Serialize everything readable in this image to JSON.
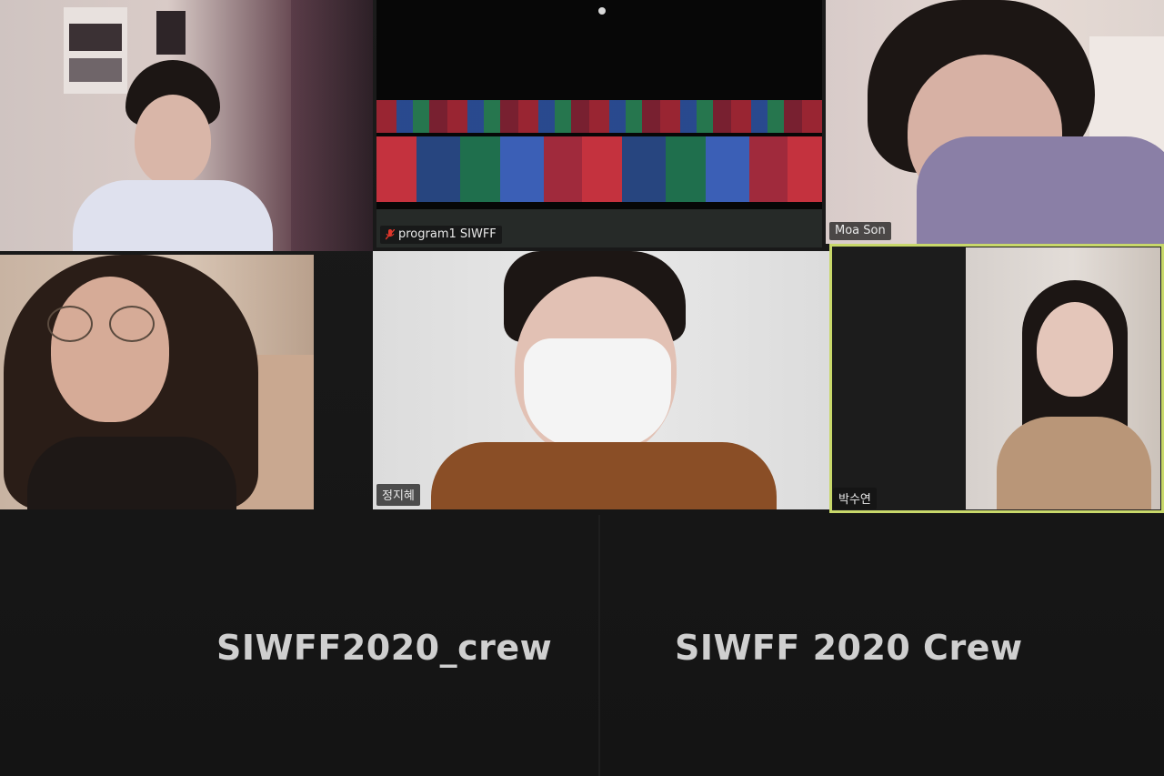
{
  "app": {
    "kind": "video-conference-gallery"
  },
  "participants": [
    {
      "id": "p1",
      "name": "",
      "muted": false,
      "active": false
    },
    {
      "id": "p2",
      "name": "program1 SIWFF",
      "muted": true,
      "active": false
    },
    {
      "id": "p3",
      "name": "Moa Son",
      "muted": false,
      "active": false
    },
    {
      "id": "p4",
      "name": "",
      "muted": false,
      "active": false
    },
    {
      "id": "p5",
      "name": "정지혜",
      "muted": false,
      "active": false
    },
    {
      "id": "p6",
      "name": "박수연",
      "muted": false,
      "active": true
    }
  ],
  "bottom_tiles": [
    {
      "label": "SIWFF2020_crew"
    },
    {
      "label": "SIWFF 2020 Crew"
    }
  ],
  "colors": {
    "active_border": "#c8d86a",
    "muted_icon": "#e0362b",
    "background": "#151515"
  },
  "icons": {
    "muted": "mic-muted-icon"
  }
}
